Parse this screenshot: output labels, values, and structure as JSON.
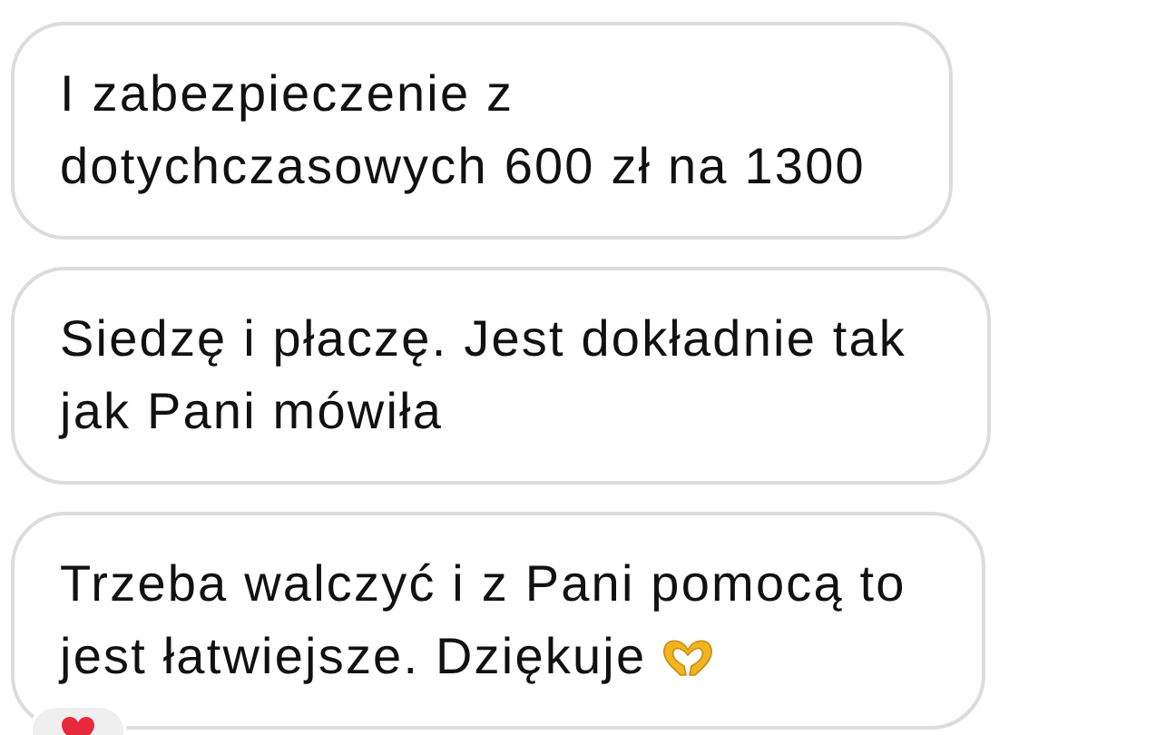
{
  "messages": [
    {
      "text": "I zabezpieczenie z dotychczasowych 600 zł na 1300",
      "emoji": false,
      "reaction": false
    },
    {
      "text": "Siedzę i płaczę. Jest dokładnie tak jak Pani mówiła",
      "emoji": false,
      "reaction": false
    },
    {
      "text": "Trzeba walczyć i z Pani pomocą to jest łatwiejsze. Dziękuje",
      "emoji": true,
      "reaction": true
    }
  ]
}
